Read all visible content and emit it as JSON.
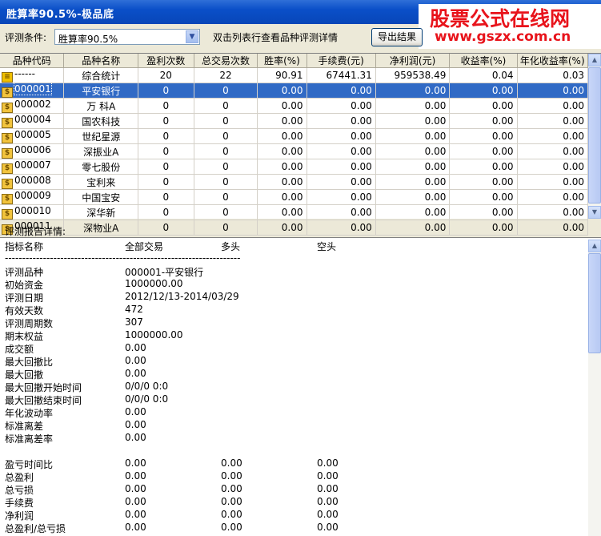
{
  "window": {
    "title": "胜算率90.5%-极品底"
  },
  "brand": {
    "line1": "股票公式在线网",
    "line2": "www.gszx.com.cn"
  },
  "toolbar": {
    "condition_label": "评测条件:",
    "condition_value": "胜算率90.5%",
    "hint": "双击列表行查看品种评测详情",
    "export_label": "导出结果"
  },
  "table": {
    "columns": [
      "品种代码",
      "品种名称",
      "盈利次数",
      "总交易次数",
      "胜率(%)",
      "手续费(元)",
      "净利润(元)",
      "收益率(%)",
      "年化收益率(%)"
    ],
    "rows": [
      {
        "code": "------",
        "name": "综合统计",
        "wins": "20",
        "total": "22",
        "winrate": "90.91",
        "fee": "67441.31",
        "profit": "959538.49",
        "ret": "0.04",
        "annual": "0.03",
        "icon": "summary-icon"
      },
      {
        "code": "000001",
        "name": "平安银行",
        "wins": "0",
        "total": "0",
        "winrate": "0.00",
        "fee": "0.00",
        "profit": "0.00",
        "ret": "0.00",
        "annual": "0.00",
        "icon": "stock-icon"
      },
      {
        "code": "000002",
        "name": "万  科A",
        "wins": "0",
        "total": "0",
        "winrate": "0.00",
        "fee": "0.00",
        "profit": "0.00",
        "ret": "0.00",
        "annual": "0.00",
        "icon": "stock-icon"
      },
      {
        "code": "000004",
        "name": "国农科技",
        "wins": "0",
        "total": "0",
        "winrate": "0.00",
        "fee": "0.00",
        "profit": "0.00",
        "ret": "0.00",
        "annual": "0.00",
        "icon": "stock-icon"
      },
      {
        "code": "000005",
        "name": "世纪星源",
        "wins": "0",
        "total": "0",
        "winrate": "0.00",
        "fee": "0.00",
        "profit": "0.00",
        "ret": "0.00",
        "annual": "0.00",
        "icon": "stock-icon"
      },
      {
        "code": "000006",
        "name": "深振业A",
        "wins": "0",
        "total": "0",
        "winrate": "0.00",
        "fee": "0.00",
        "profit": "0.00",
        "ret": "0.00",
        "annual": "0.00",
        "icon": "stock-icon"
      },
      {
        "code": "000007",
        "name": "零七股份",
        "wins": "0",
        "total": "0",
        "winrate": "0.00",
        "fee": "0.00",
        "profit": "0.00",
        "ret": "0.00",
        "annual": "0.00",
        "icon": "stock-icon"
      },
      {
        "code": "000008",
        "name": "宝利来",
        "wins": "0",
        "total": "0",
        "winrate": "0.00",
        "fee": "0.00",
        "profit": "0.00",
        "ret": "0.00",
        "annual": "0.00",
        "icon": "stock-icon"
      },
      {
        "code": "000009",
        "name": "中国宝安",
        "wins": "0",
        "total": "0",
        "winrate": "0.00",
        "fee": "0.00",
        "profit": "0.00",
        "ret": "0.00",
        "annual": "0.00",
        "icon": "stock-icon"
      },
      {
        "code": "000010",
        "name": "深华新",
        "wins": "0",
        "total": "0",
        "winrate": "0.00",
        "fee": "0.00",
        "profit": "0.00",
        "ret": "0.00",
        "annual": "0.00",
        "icon": "stock-icon"
      },
      {
        "code": "000011",
        "name": "深物业A",
        "wins": "0",
        "total": "0",
        "winrate": "0.00",
        "fee": "0.00",
        "profit": "0.00",
        "ret": "0.00",
        "annual": "0.00",
        "icon": "stock-icon"
      }
    ],
    "selected_row": 1
  },
  "report": {
    "label": "评测报告详情:",
    "headers": [
      "指标名称",
      "全部交易",
      "多头",
      "空头"
    ],
    "separator": "--------------------------------------------------------------------",
    "section1": [
      {
        "name": "评测品种",
        "all": "000001-平安银行"
      },
      {
        "name": "初始资金",
        "all": "1000000.00"
      },
      {
        "name": "评测日期",
        "all": "2012/12/13-2014/03/29"
      },
      {
        "name": "有效天数",
        "all": "472"
      },
      {
        "name": "评测周期数",
        "all": "307"
      },
      {
        "name": "期末权益",
        "all": "1000000.00"
      },
      {
        "name": "成交额",
        "all": "0.00"
      },
      {
        "name": "最大回撤比",
        "all": "0.00"
      },
      {
        "name": "最大回撤",
        "all": "0.00"
      },
      {
        "name": "最大回撤开始时间",
        "all": "0/0/0 0:0"
      },
      {
        "name": "最大回撤结束时间",
        "all": "0/0/0 0:0"
      },
      {
        "name": "年化波动率",
        "all": "0.00"
      },
      {
        "name": "标准离差",
        "all": "0.00"
      },
      {
        "name": "标准离差率",
        "all": "0.00"
      }
    ],
    "section2": [
      {
        "name": "盈亏时间比",
        "all": "0.00",
        "long": "0.00",
        "short": "0.00"
      },
      {
        "name": "总盈利",
        "all": "0.00",
        "long": "0.00",
        "short": "0.00"
      },
      {
        "name": "总亏损",
        "all": "0.00",
        "long": "0.00",
        "short": "0.00"
      },
      {
        "name": "手续费",
        "all": "0.00",
        "long": "0.00",
        "short": "0.00"
      },
      {
        "name": "净利润",
        "all": "0.00",
        "long": "0.00",
        "short": "0.00"
      },
      {
        "name": "总盈利/总亏损",
        "all": "0.00",
        "long": "0.00",
        "short": "0.00"
      }
    ]
  }
}
